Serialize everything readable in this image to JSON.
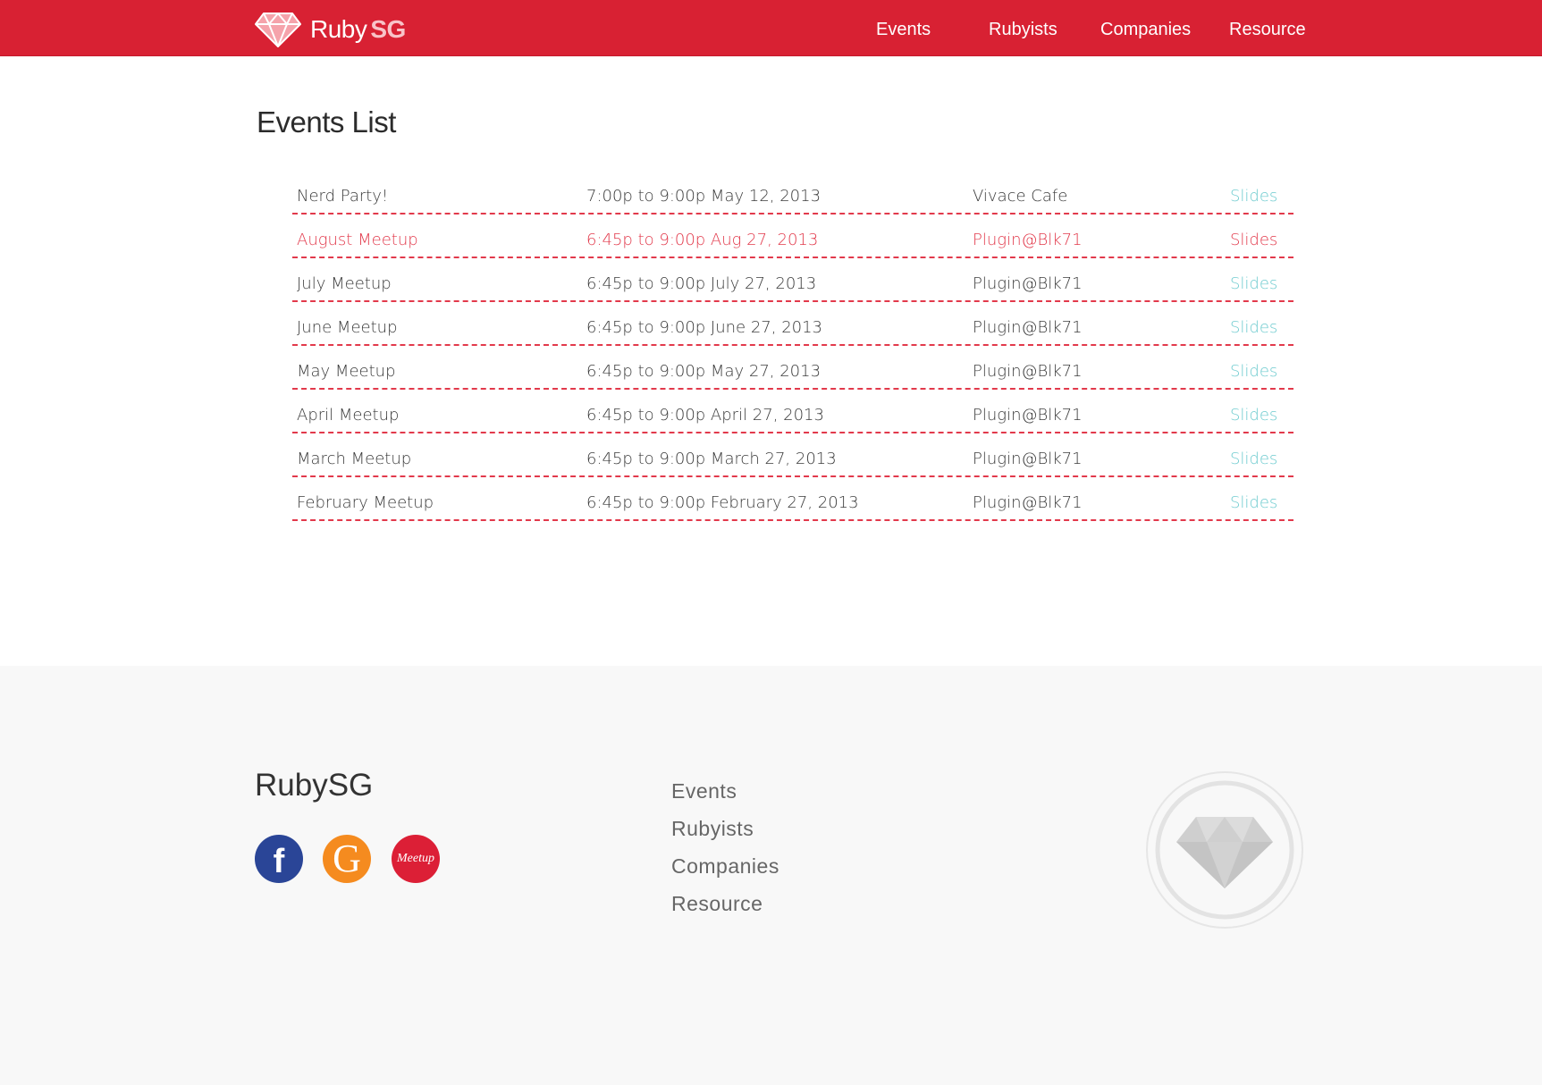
{
  "header": {
    "logo": {
      "text": "Ruby",
      "accent": "SG",
      "icon": "ruby-gem-icon"
    },
    "nav": [
      {
        "label": "Events"
      },
      {
        "label": "Rubyists"
      },
      {
        "label": "Companies"
      },
      {
        "label": "Resource"
      }
    ]
  },
  "main": {
    "title": "Events List",
    "events": [
      {
        "name": "Nerd Party!",
        "time": "7:00p to 9:00p May 12, 2013",
        "venue": "Vivace Cafe",
        "link": "Slides",
        "highlighted": false
      },
      {
        "name": "August Meetup",
        "time": "6:45p to 9:00p Aug 27, 2013",
        "venue": "Plugin@Blk71",
        "link": "Slides",
        "highlighted": true
      },
      {
        "name": "July Meetup",
        "time": "6:45p to 9:00p July 27, 2013",
        "venue": "Plugin@Blk71",
        "link": "Slides",
        "highlighted": false
      },
      {
        "name": "June Meetup",
        "time": "6:45p to 9:00p June 27, 2013",
        "venue": "Plugin@Blk71",
        "link": "Slides",
        "highlighted": false
      },
      {
        "name": "May Meetup",
        "time": "6:45p to 9:00p May 27, 2013",
        "venue": "Plugin@Blk71",
        "link": "Slides",
        "highlighted": false
      },
      {
        "name": "April Meetup",
        "time": "6:45p to 9:00p April 27, 2013",
        "venue": "Plugin@Blk71",
        "link": "Slides",
        "highlighted": false
      },
      {
        "name": "March Meetup",
        "time": "6:45p to 9:00p March 27, 2013",
        "venue": "Plugin@Blk71",
        "link": "Slides",
        "highlighted": false
      },
      {
        "name": "February Meetup",
        "time": "6:45p to 9:00p February 27, 2013",
        "venue": "Plugin@Blk71",
        "link": "Slides",
        "highlighted": false
      }
    ]
  },
  "footer": {
    "brand": "RubySG",
    "social": [
      {
        "icon": "facebook-icon",
        "glyph": "f"
      },
      {
        "icon": "github-icon",
        "glyph": "G"
      },
      {
        "icon": "meetup-icon",
        "glyph": "Meetup"
      }
    ],
    "links": [
      {
        "label": "Events"
      },
      {
        "label": "Rubyists"
      },
      {
        "label": "Companies"
      },
      {
        "label": "Resource"
      }
    ],
    "badge_icon": "ruby-gem-badge-icon"
  },
  "colors": {
    "brand_red": "#d82133",
    "highlight_red": "#e2394b",
    "link_teal": "#6ecbcf",
    "footer_bg": "#f8f8f8",
    "facebook_blue": "#2a4597",
    "github_orange": "#f58b1f",
    "meetup_red": "#dc1f36"
  }
}
